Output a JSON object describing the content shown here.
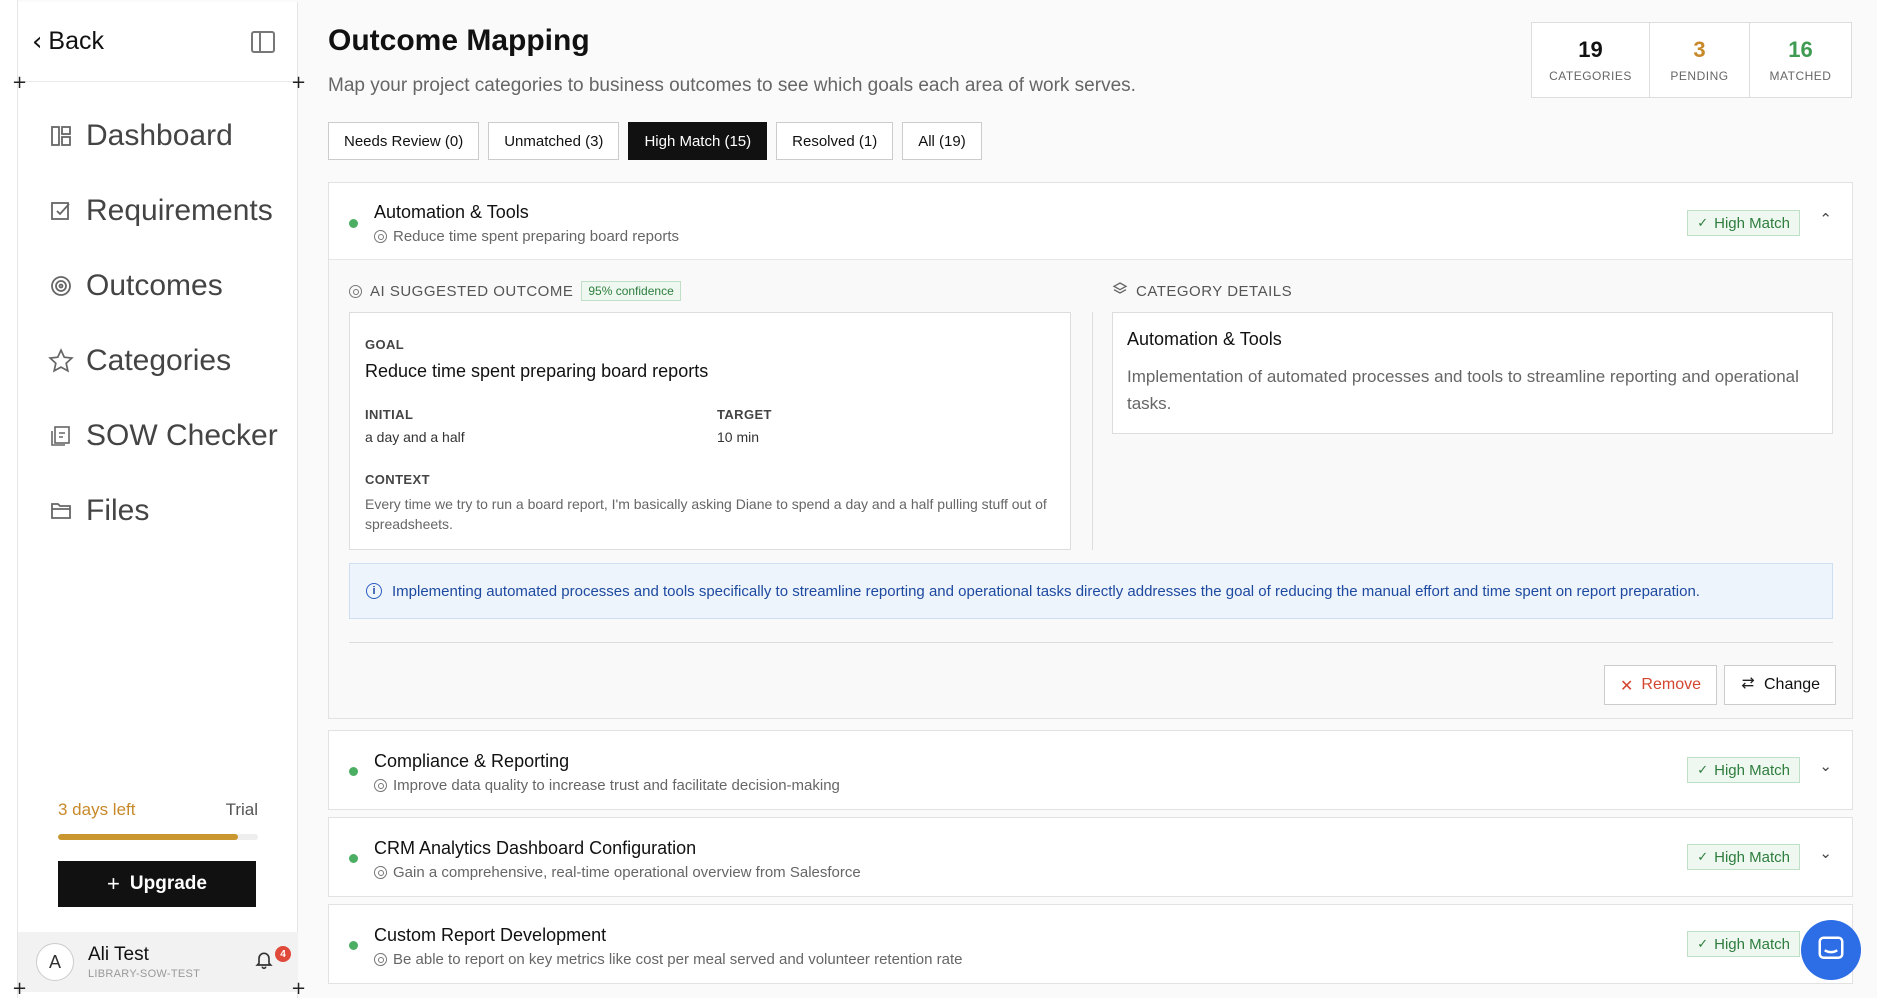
{
  "sidebar": {
    "back_label": "Back",
    "nav": [
      {
        "label": "Dashboard",
        "icon": "dashboard-icon"
      },
      {
        "label": "Requirements",
        "icon": "checkbox-icon"
      },
      {
        "label": "Outcomes",
        "icon": "target-icon"
      },
      {
        "label": "Categories",
        "icon": "star-icon"
      },
      {
        "label": "SOW Checker",
        "icon": "document-check-icon"
      },
      {
        "label": "Files",
        "icon": "folder-icon"
      }
    ],
    "trial": {
      "days_left": "3 days left",
      "label": "Trial",
      "progress": 0.9
    },
    "upgrade_label": "Upgrade",
    "user": {
      "initial": "A",
      "name": "Ali Test",
      "org": "LIBRARY-SOW-TEST",
      "notifications": "4"
    }
  },
  "header": {
    "title": "Outcome Mapping",
    "subtitle": "Map your project categories to business outcomes to see which goals each area of work serves."
  },
  "stats": [
    {
      "value": "19",
      "label": "CATEGORIES",
      "color": "#111111"
    },
    {
      "value": "3",
      "label": "PENDING",
      "color": "#c7892a"
    },
    {
      "value": "16",
      "label": "MATCHED",
      "color": "#3f9b52"
    }
  ],
  "filters": [
    {
      "label": "Needs Review (0)",
      "active": false
    },
    {
      "label": "Unmatched (3)",
      "active": false
    },
    {
      "label": "High Match (15)",
      "active": true
    },
    {
      "label": "Resolved (1)",
      "active": false
    },
    {
      "label": "All (19)",
      "active": false
    }
  ],
  "expanded": {
    "title": "Automation & Tools",
    "goal": "Reduce time spent preparing board reports",
    "badge": "High Match",
    "ai_label": "AI SUGGESTED OUTCOME",
    "confidence": "95% confidence",
    "goal_label": "GOAL",
    "goal_value": "Reduce time spent preparing board reports",
    "initial_label": "INITIAL",
    "initial_value": "a day and a half",
    "target_label": "TARGET",
    "target_value": "10 min",
    "context_label": "CONTEXT",
    "context_value": "Every time we try to run a board report, I'm basically asking Diane to spend a day and a half pulling stuff out of spreadsheets.",
    "cat_label": "CATEGORY DETAILS",
    "cat_title": "Automation & Tools",
    "cat_desc": "Implementation of automated processes and tools to streamline reporting and operational tasks.",
    "info": "Implementing automated processes and tools specifically to streamline reporting and operational tasks directly addresses the goal of reducing the manual effort and time spent on report preparation.",
    "remove_label": "Remove",
    "change_label": "Change"
  },
  "cards": [
    {
      "title": "Compliance & Reporting",
      "goal": "Improve data quality to increase trust and facilitate decision-making",
      "badge": "High Match"
    },
    {
      "title": "CRM Analytics Dashboard Configuration",
      "goal": "Gain a comprehensive, real-time operational overview from Salesforce",
      "badge": "High Match"
    },
    {
      "title": "Custom Report Development",
      "goal": "Be able to report on key metrics like cost per meal served and volunteer retention rate",
      "badge": "High Match"
    }
  ]
}
